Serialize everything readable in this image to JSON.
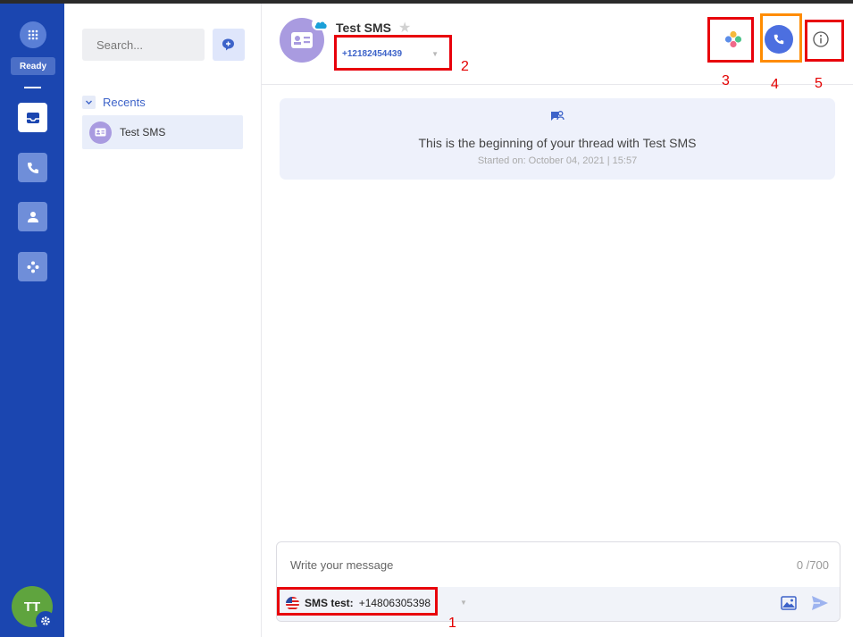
{
  "rail": {
    "status": "Ready",
    "user_initials": "TT"
  },
  "recents_panel": {
    "search_placeholder": "Search...",
    "section_title": "Recents",
    "items": [
      {
        "name": "Test SMS"
      }
    ]
  },
  "header": {
    "contact_name": "Test SMS",
    "phone_number": "+12182454439"
  },
  "thread": {
    "beginning_text": "This is the beginning of your thread with Test SMS",
    "started_on": "Started on: October 04, 2021 | 15:57"
  },
  "composer": {
    "placeholder": "Write your message",
    "counter": "0 /700",
    "sender_label": "SMS test:",
    "sender_number": "+14806305398"
  },
  "annotations": {
    "labels": [
      "1",
      "2",
      "3",
      "4",
      "5"
    ]
  },
  "colors": {
    "rail": "#1b46b0",
    "accent": "#3d63c9",
    "call_button": "#4c6fe0",
    "annotation_red": "#e8000b",
    "annotation_orange": "#ff8c00"
  }
}
